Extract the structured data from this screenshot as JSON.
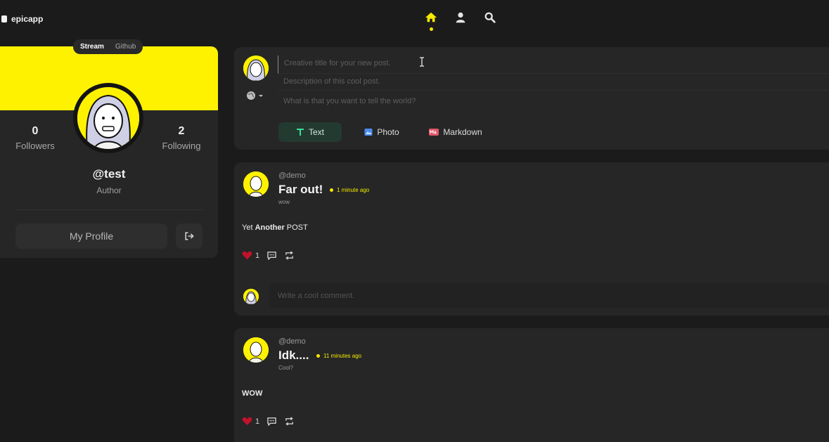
{
  "brand": {
    "name": "epicapp"
  },
  "nav": {
    "items": [
      "home-icon",
      "user-icon",
      "search-icon"
    ],
    "active": "home-icon",
    "accent": "#f5e900"
  },
  "profile": {
    "tabs": [
      {
        "label": "Stream",
        "active": true
      },
      {
        "label": "Github",
        "active": false
      }
    ],
    "followers_count": "0",
    "followers_label": "Followers",
    "following_count": "2",
    "following_label": "Following",
    "handle": "@test",
    "role": "Author",
    "my_profile_label": "My Profile",
    "banner_color": "#fff200"
  },
  "composer": {
    "title_placeholder": "Creative title for your new post.",
    "description_placeholder": "Description of this cool post.",
    "body_placeholder": "What is that you want to tell the world?",
    "types": [
      {
        "label": "Text",
        "icon": "text-icon"
      },
      {
        "label": "Photo",
        "icon": "image-icon"
      },
      {
        "label": "Markdown",
        "icon": "markdown-icon"
      }
    ]
  },
  "posts": [
    {
      "author": "@demo",
      "title": "Far out!",
      "time": "1 minute ago",
      "subtitle": "wow",
      "body_parts": [
        "Yet ",
        "Another",
        " POST"
      ],
      "likes": "1",
      "comment_placeholder": "Write a cool comment."
    },
    {
      "author": "@demo",
      "title": "Idk....",
      "time": "11 minutes ago",
      "subtitle": "Cool?",
      "body": "WOW",
      "likes": "1"
    }
  ]
}
